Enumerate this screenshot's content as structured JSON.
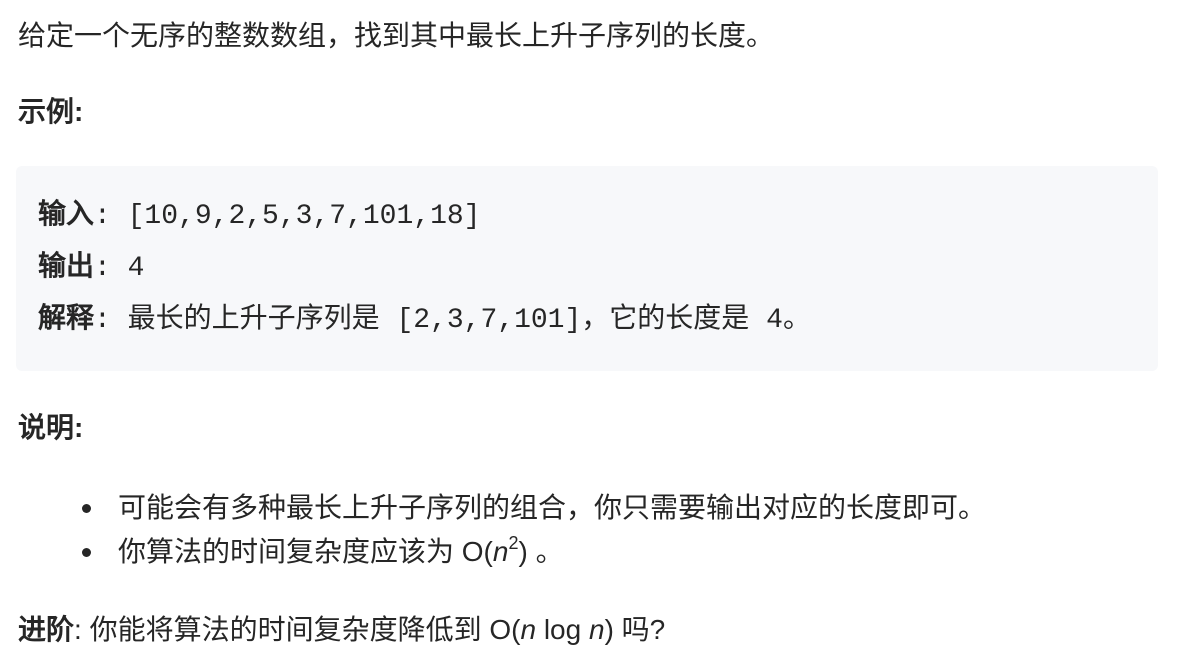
{
  "intro": "给定一个无序的整数数组，找到其中最长上升子序列的长度。",
  "example": {
    "heading": "示例:",
    "input_label": "输入",
    "input_value": "[10,9,2,5,3,7,101,18]",
    "output_label": "输出",
    "output_value": "4",
    "explain_label": "解释",
    "explain_pre": "最长的上升子序列是",
    "explain_seq": "[2,3,7,101]",
    "explain_post": "，它的长度是",
    "explain_num": "4",
    "explain_end": "。"
  },
  "notes": {
    "heading": "说明:",
    "item1": "可能会有多种最长上升子序列的组合，你只需要输出对应的长度即可。",
    "item2_pre": "你算法的时间复杂度应该为 O(",
    "item2_n": "n",
    "item2_exp": "2",
    "item2_post": ") 。"
  },
  "advance": {
    "label": "进阶",
    "text_pre": ": 你能将算法的时间复杂度降低到 O(",
    "n1": "n",
    "log": " log ",
    "n2": "n",
    "text_post": ") 吗?"
  }
}
